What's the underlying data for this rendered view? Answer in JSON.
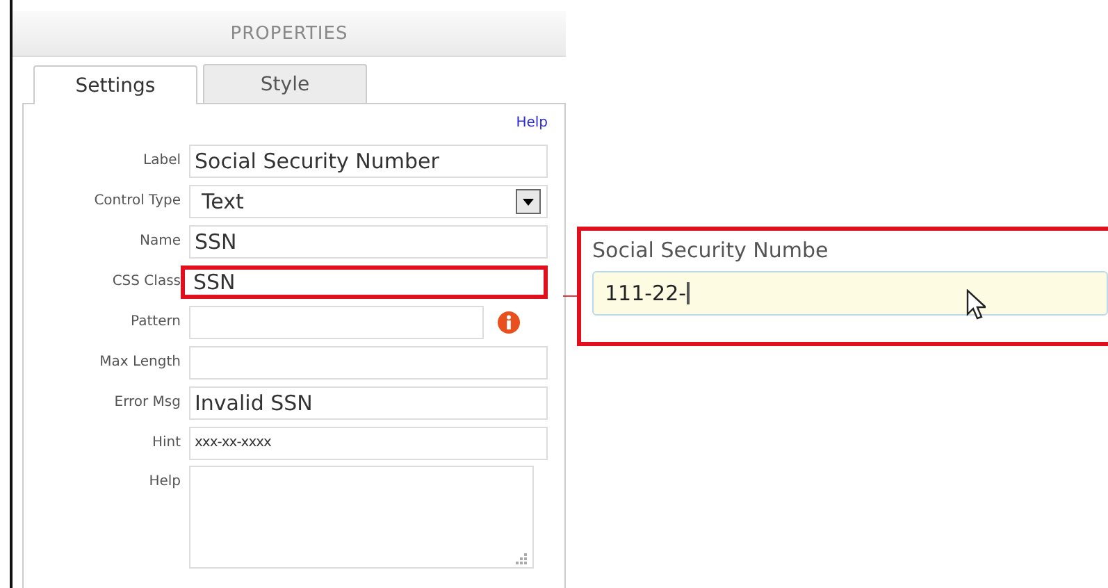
{
  "panel": {
    "title": "PROPERTIES"
  },
  "tabs": [
    {
      "label": "Settings",
      "selected": true
    },
    {
      "label": "Style",
      "selected": false
    }
  ],
  "help_link": "Help",
  "fields": [
    {
      "label": "Label",
      "kind": "text",
      "value": "Social Security Number",
      "highlighted": false,
      "info": false
    },
    {
      "label": "Control Type",
      "kind": "select",
      "value": "Text"
    },
    {
      "label": "Name",
      "kind": "text",
      "value": "SSN",
      "highlighted": false,
      "info": false
    },
    {
      "label": "CSS Class",
      "kind": "text",
      "value": "SSN",
      "highlighted": true,
      "info": false
    },
    {
      "label": "Pattern",
      "kind": "text",
      "highlighted": false,
      "info": true
    },
    {
      "label": "Max Length",
      "kind": "text",
      "highlighted": false,
      "info": false
    },
    {
      "label": "Error Msg",
      "kind": "text",
      "value": "Invalid SSN",
      "highlighted": false,
      "info": false
    },
    {
      "label": "Hint",
      "kind": "hint",
      "value": "xxx-xx-xxxx",
      "highlighted": false,
      "info": false
    },
    {
      "label": "Help",
      "kind": "textarea"
    }
  ],
  "preview": {
    "label": "Social Security Numbe",
    "value": "111-22-"
  }
}
